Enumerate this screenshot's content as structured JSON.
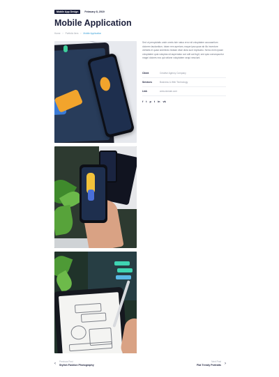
{
  "header": {
    "category_badge": "Mobile App Design",
    "date": "February 8, 2019",
    "title": "Mobile Application",
    "breadcrumb": [
      "Home",
      "Portfolio Item",
      "Mobile Application"
    ]
  },
  "details": {
    "description": "Sed ut perspiciatis unde omnis iste natus error sit voluptatem accusantium dolorem laudantium, totam rem aperiam, eaque ipsa quae ab illo inventore veritatis et quasi architecto beatae vitae dicta sunt explicabo. Nemo enim ipsam voluptatem quia voluptas sit aspernatur aut odit aut fugit, sed quia consequuntur magni dolores eos qui ratione voluptatem sequi nesciunt.",
    "fields": [
      {
        "label": "Client",
        "value": "Creative Agency Company"
      },
      {
        "label": "Services",
        "value": "Business & Web Technology"
      },
      {
        "label": "Link",
        "value": "www.domain.com"
      }
    ],
    "social_icons": [
      "facebook-icon",
      "twitter-icon",
      "pinterest-icon",
      "tumblr-icon",
      "linkedin-icon",
      "vk-icon"
    ],
    "social_glyphs": [
      "f",
      "t",
      "p",
      "t",
      "in",
      "vk"
    ]
  },
  "gallery": {
    "images": [
      "mobile-app-phones-image",
      "hand-holding-phone-image",
      "tablet-sketch-image"
    ]
  },
  "post_nav": {
    "prev_label": "Previous Post",
    "prev_title": "Stylish Fashion Photography",
    "next_label": "Next Post",
    "next_title": "Flat Trendy Portraits",
    "prev_arrow": "‹",
    "next_arrow": "›"
  }
}
